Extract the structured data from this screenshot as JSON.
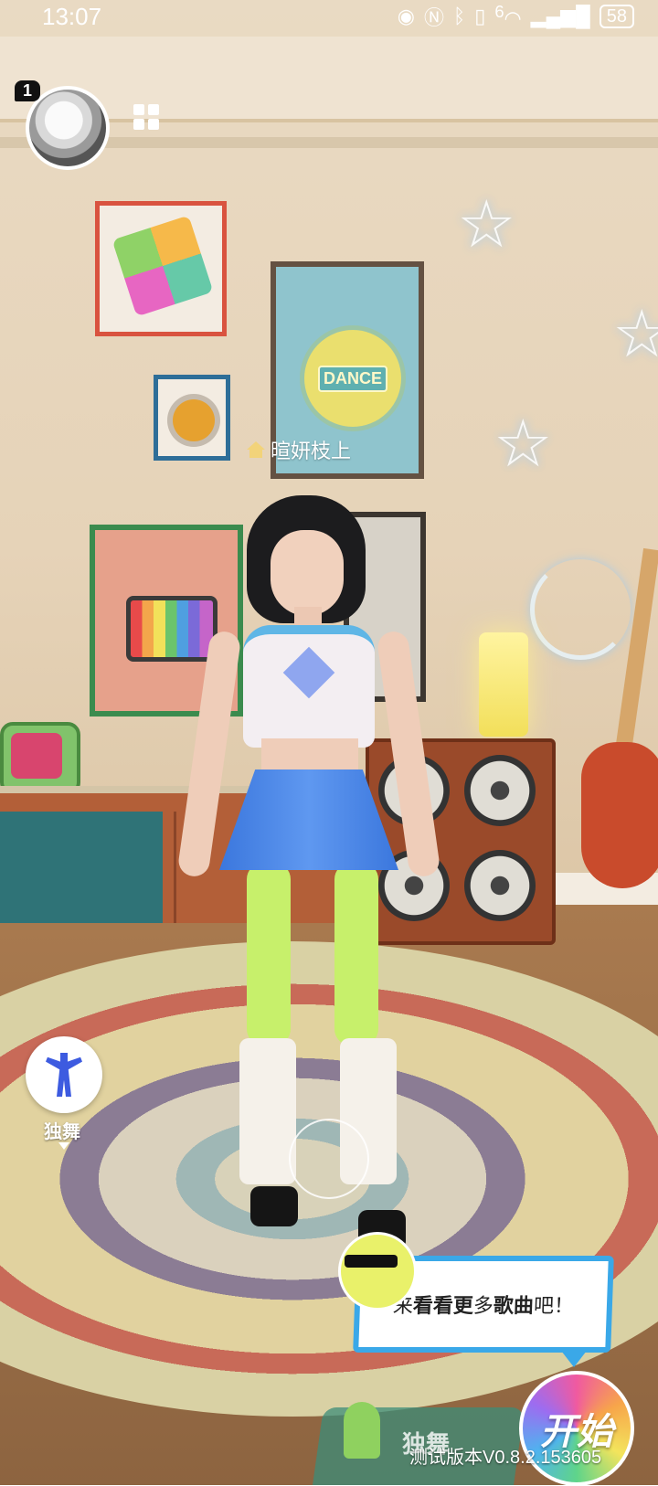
{
  "status_bar": {
    "time": "13:07",
    "icons": [
      "eye-icon",
      "nfc-icon",
      "bluetooth-icon",
      "vibrate-icon",
      "wifi-icon",
      "signal-icon"
    ],
    "wifi_label": "6",
    "battery": "58"
  },
  "header": {
    "notification_count": "1",
    "avatar_icon": "user-avatar",
    "menu_icon": "grid-icon"
  },
  "scene": {
    "player_name": "暄妍枝上",
    "poster_text": "DANCE"
  },
  "controls": {
    "solo_label": "独舞",
    "bubble": {
      "part1": "来",
      "part2": "看看更",
      "part3": "多",
      "part4": "歌曲",
      "part5": "吧！"
    },
    "start_label": "开始",
    "tab_label": "独舞",
    "version": "测试版本V0.8.2.153605"
  }
}
